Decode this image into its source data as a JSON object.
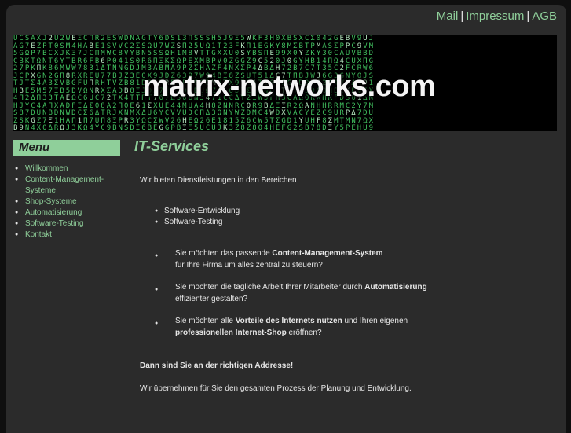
{
  "top_links": {
    "mail": "Mail",
    "sep1": "|",
    "impressum": "Impressum",
    "sep2": "|",
    "agb": "AGB"
  },
  "banner": {
    "brand": "matrix-networks.com"
  },
  "menu": {
    "heading": "Menu",
    "items": [
      "Willkommen",
      "Content-Management-Systeme",
      "Shop-Systeme",
      "Automatisierung",
      "Software-Testing",
      "Kontakt"
    ]
  },
  "main": {
    "title": "IT-Services",
    "intro": "Wir bieten Dienstleistungen in den Bereichen",
    "services": [
      "Software-Entwicklung",
      "Software-Testing"
    ],
    "questions": [
      {
        "l1a": "Sie möchten das passende ",
        "l1b": "Content-Management-System",
        "l2a": "für Ihre Firma um alles zentral zu steuern?"
      },
      {
        "l1a": "Sie möchten die tägliche Arbeit Ihrer Mitarbeiter durch ",
        "l1b": "Automatisierung",
        "l2a": "effizienter gestalten?"
      },
      {
        "l1a": "Sie möchten alle ",
        "l1b": "Vorteile des Internets nutzen",
        "l1c": " und Ihren eigenen",
        "l2b": "professionellen Internet-Shop",
        "l2c": " eröffnen?"
      }
    ],
    "final": "Dann sind Sie an der richtigen Addresse!",
    "closing": "Wir übernehmen für Sie den gesamten Prozess der Planung und Entwicklung."
  }
}
